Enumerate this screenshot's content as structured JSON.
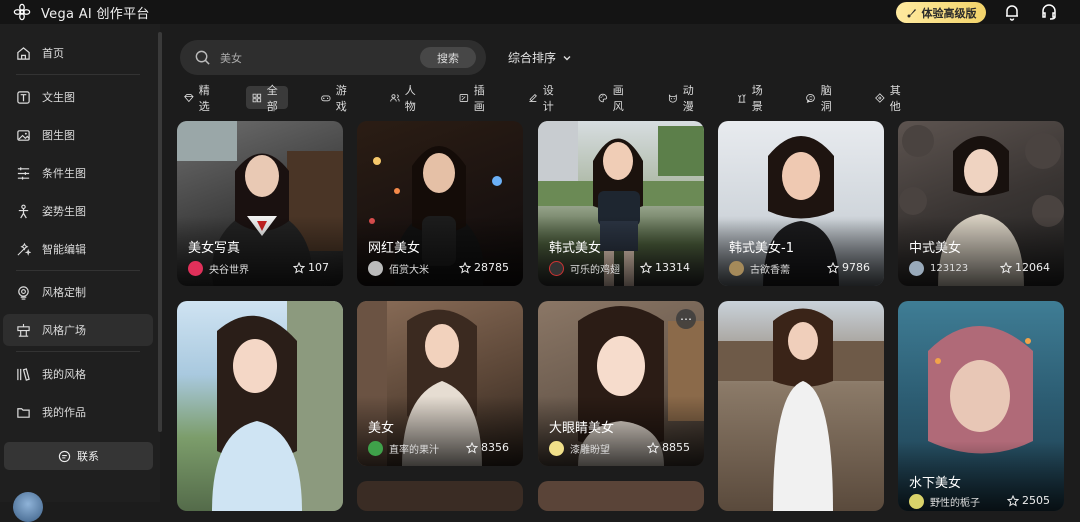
{
  "app": {
    "title": "Vega AI 创作平台",
    "upgrade_label": "体验高级版"
  },
  "sidebar": {
    "items": [
      {
        "label": "首页",
        "icon": "home-icon"
      },
      {
        "label": "文生图",
        "icon": "text-image-icon"
      },
      {
        "label": "图生图",
        "icon": "image-icon"
      },
      {
        "label": "条件生图",
        "icon": "condition-icon"
      },
      {
        "label": "姿势生图",
        "icon": "pose-icon"
      },
      {
        "label": "智能编辑",
        "icon": "magic-edit-icon"
      },
      {
        "label": "风格定制",
        "icon": "style-custom-icon"
      },
      {
        "label": "风格广场",
        "icon": "style-square-icon"
      },
      {
        "label": "我的风格",
        "icon": "my-style-icon"
      },
      {
        "label": "我的作品",
        "icon": "folder-icon"
      }
    ],
    "active_index": 7,
    "contact_label": "联系"
  },
  "search": {
    "value": "美女",
    "button_label": "搜索"
  },
  "sort": {
    "label": "综合排序"
  },
  "categories": [
    {
      "label": "精选",
      "icon": "diamond-icon"
    },
    {
      "label": "全部",
      "icon": "grid-icon"
    },
    {
      "label": "游戏",
      "icon": "gamepad-icon"
    },
    {
      "label": "人物",
      "icon": "people-icon"
    },
    {
      "label": "插画",
      "icon": "illustration-icon"
    },
    {
      "label": "设计",
      "icon": "design-icon"
    },
    {
      "label": "画风",
      "icon": "palette-icon"
    },
    {
      "label": "动漫",
      "icon": "anime-icon"
    },
    {
      "label": "场景",
      "icon": "scene-icon"
    },
    {
      "label": "脑洞",
      "icon": "brain-icon"
    },
    {
      "label": "其他",
      "icon": "other-icon"
    }
  ],
  "active_category_index": 1,
  "cards": [
    {
      "title": "美女写真",
      "author": "央谷世界",
      "stars": "107"
    },
    {
      "title": "网红美女",
      "author": "佰赏大米",
      "stars": "28785"
    },
    {
      "title": "韩式美女",
      "author": "可乐的鸡翅",
      "stars": "13314"
    },
    {
      "title": "韩式美女-1",
      "author": "古欲香薷",
      "stars": "9786"
    },
    {
      "title": "中式美女",
      "author": "123123",
      "stars": "12064"
    },
    {
      "title": "",
      "author": "",
      "stars": ""
    },
    {
      "title": "美女",
      "author": "直率的果汁",
      "stars": "8356"
    },
    {
      "title": "大眼睛美女",
      "author": "漆雕盼望",
      "stars": "8855"
    },
    {
      "title": "",
      "author": "",
      "stars": ""
    },
    {
      "title": "水下美女",
      "author": "野性的栀子",
      "stars": "2505"
    }
  ],
  "colors": {
    "accent": "#f5d77a",
    "background": "#1c1c1c",
    "sidebar": "#1f1f1f"
  }
}
